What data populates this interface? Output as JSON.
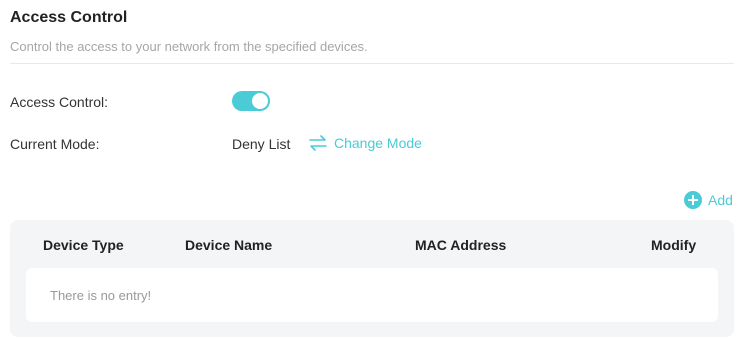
{
  "header": {
    "title": "Access Control",
    "subtitle": "Control the access to your network from the specified devices."
  },
  "settings": {
    "access_control_label": "Access Control:",
    "access_control_enabled": true,
    "current_mode_label": "Current Mode:",
    "current_mode_value": "Deny List",
    "change_mode_label": "Change Mode"
  },
  "table": {
    "add_label": "Add",
    "columns": [
      "Device Type",
      "Device Name",
      "MAC Address",
      "Modify"
    ],
    "empty_text": "There is no entry!"
  },
  "colors": {
    "accent": "#4acbd6",
    "table_background": "#f4f5f7"
  },
  "icons": {
    "change_mode": "swap-arrows-icon",
    "add": "plus-circle-icon"
  }
}
